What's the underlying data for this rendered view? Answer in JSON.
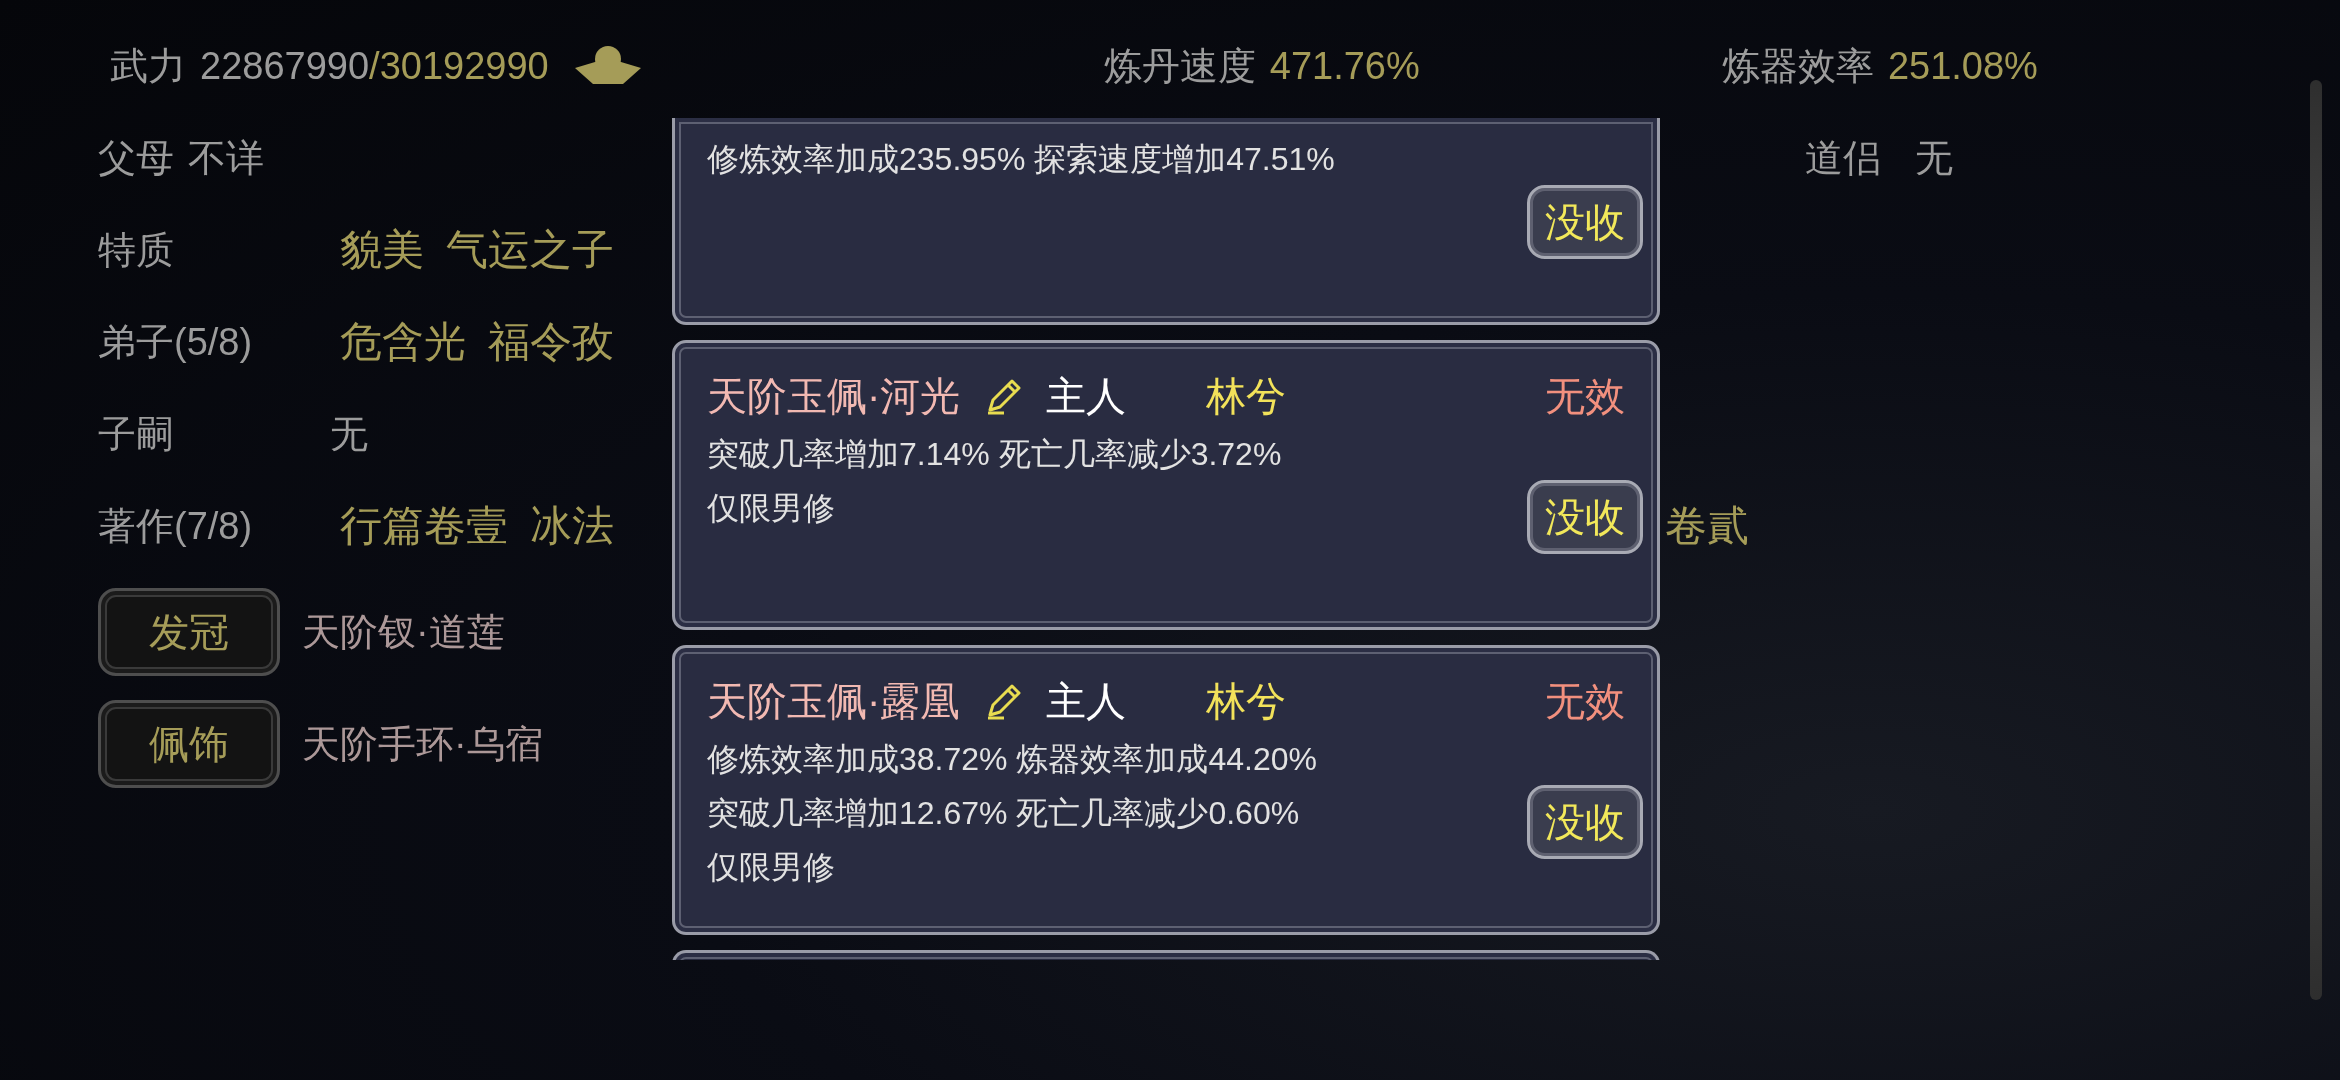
{
  "power": {
    "label": "武力",
    "current": "22867990",
    "max": "/30192990"
  },
  "stats": [
    {
      "label": "炼丹速度",
      "value": "471.76%"
    },
    {
      "label": "炼器效率",
      "value": "251.08%"
    }
  ],
  "parents": {
    "label": "父母",
    "value": "不详"
  },
  "partner": {
    "label": "道侣",
    "value": "无"
  },
  "rows": [
    {
      "label": "特质",
      "kind": "tags",
      "values": [
        "貌美",
        "气运之子"
      ]
    },
    {
      "label": "弟子(5/8)",
      "kind": "tags",
      "values": [
        "危含光",
        "福令孜"
      ]
    },
    {
      "label": "子嗣",
      "kind": "plain",
      "values": [
        "无"
      ]
    },
    {
      "label": "著作(7/8)",
      "kind": "tags",
      "values": [
        "行篇卷壹",
        "冰法"
      ],
      "tail": "卷貳"
    }
  ],
  "equipment": [
    {
      "slot": "发冠",
      "item": "天阶钗·道莲"
    },
    {
      "slot": "佩饰",
      "item": "天阶手环·乌宿"
    }
  ],
  "cards": [
    {
      "kind": "partial_top",
      "effects": [
        "修炼效率加成235.95% 探索速度增加47.51%"
      ],
      "action": "没收"
    },
    {
      "kind": "full",
      "title": "天阶玉佩·河光",
      "owner_label": "主人",
      "owner": "林兮",
      "status": "无效",
      "effects": [
        "突破几率增加7.14% 死亡几率减少3.72%",
        "仅限男修"
      ],
      "action": "没收"
    },
    {
      "kind": "full",
      "title": "天阶玉佩·露凰",
      "owner_label": "主人",
      "owner": "林兮",
      "status": "无效",
      "effects": [
        "修炼效率加成38.72% 炼器效率加成44.20%",
        "突破几率增加12.67% 死亡几率减少0.60%",
        "仅限男修"
      ],
      "action": "没收"
    },
    {
      "kind": "partial_bottom"
    }
  ]
}
